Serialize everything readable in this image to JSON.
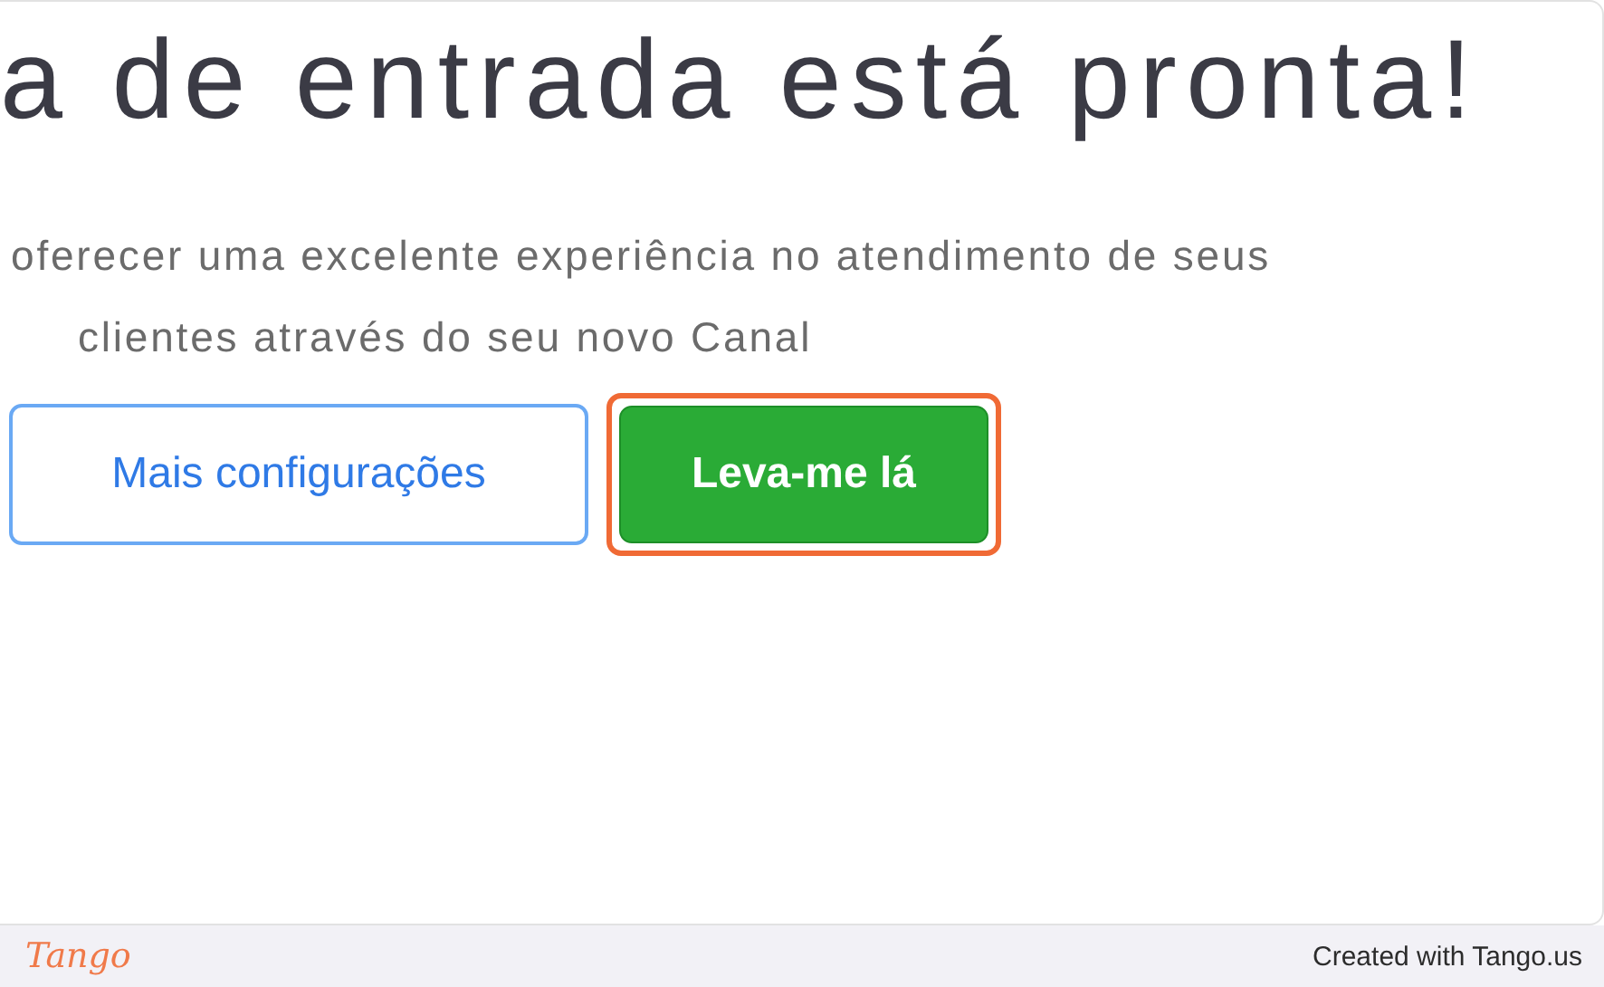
{
  "heading": "a de entrada está pronta!",
  "description_lines": [
    "oferecer uma excelente experiência no atendimento de seus",
    "clientes através do seu novo Canal"
  ],
  "buttons": [
    {
      "label": "Mais configurações",
      "kind": "outline",
      "highlighted": false
    },
    {
      "label": "Leva-me lá",
      "kind": "primary",
      "highlighted": true
    }
  ],
  "footer": {
    "logo": "Tango",
    "credit": "Created with Tango.us"
  }
}
